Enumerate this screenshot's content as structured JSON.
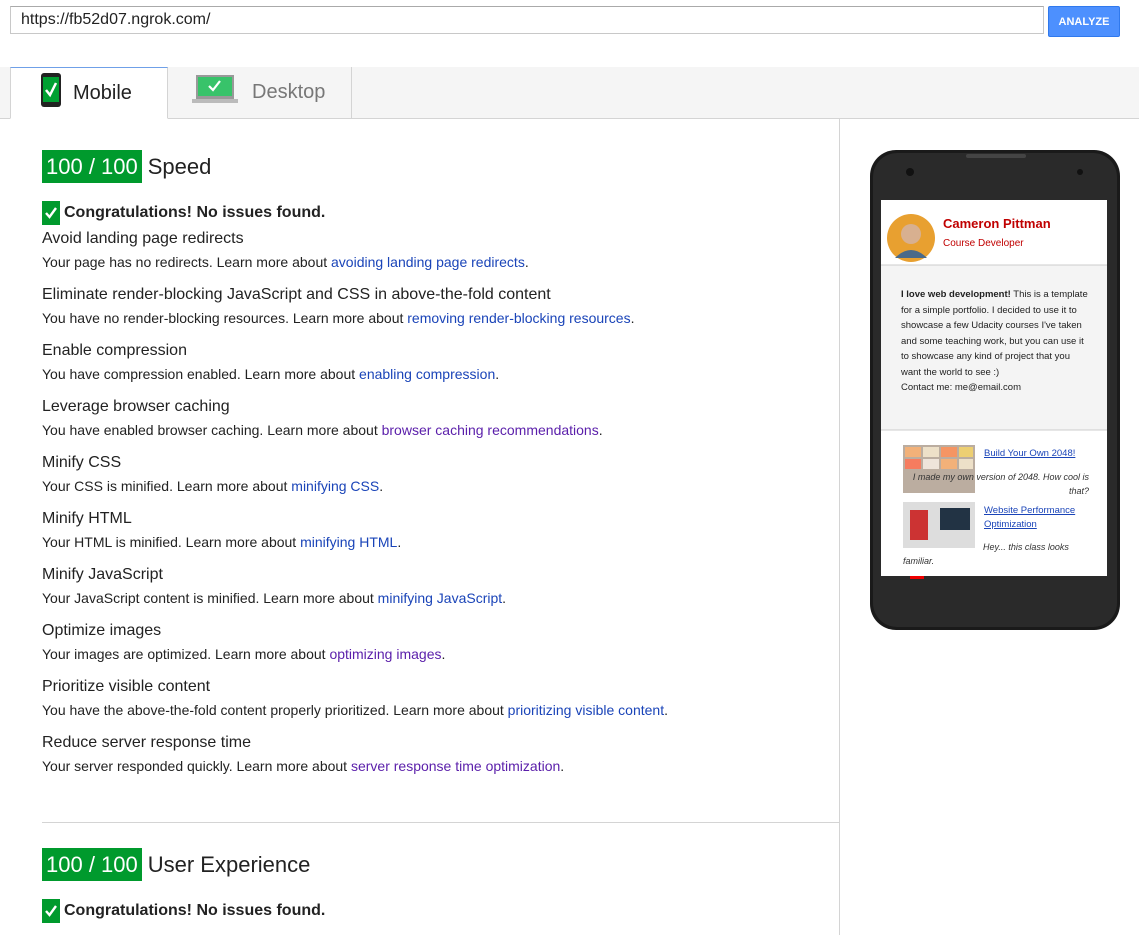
{
  "url_bar": {
    "value": "https://fb52d07.ngrok.com/",
    "analyze_label": "ANALYZE"
  },
  "tabs": [
    {
      "label": "Mobile",
      "active": true
    },
    {
      "label": "Desktop",
      "active": false
    }
  ],
  "speed": {
    "score": "100 / 100",
    "label": "Speed",
    "congrats": "Congratulations! No issues found.",
    "rules": [
      {
        "title": "Avoid landing page redirects",
        "desc": "Your page has no redirects. Learn more about ",
        "link": "avoiding landing page redirects",
        "visited": false
      },
      {
        "title": "Eliminate render-blocking JavaScript and CSS in above-the-fold content",
        "desc": "You have no render-blocking resources. Learn more about ",
        "link": "removing render-blocking resources",
        "visited": false
      },
      {
        "title": "Enable compression",
        "desc": "You have compression enabled. Learn more about ",
        "link": "enabling compression",
        "visited": false
      },
      {
        "title": "Leverage browser caching",
        "desc": "You have enabled browser caching. Learn more about ",
        "link": "browser caching recommendations",
        "visited": true
      },
      {
        "title": "Minify CSS",
        "desc": "Your CSS is minified. Learn more about ",
        "link": "minifying CSS",
        "visited": false
      },
      {
        "title": "Minify HTML",
        "desc": "Your HTML is minified. Learn more about ",
        "link": "minifying HTML",
        "visited": false
      },
      {
        "title": "Minify JavaScript",
        "desc": "Your JavaScript content is minified. Learn more about ",
        "link": "minifying JavaScript",
        "visited": false
      },
      {
        "title": "Optimize images",
        "desc": "Your images are optimized. Learn more about ",
        "link": "optimizing images",
        "visited": true
      },
      {
        "title": "Prioritize visible content",
        "desc": "You have the above-the-fold content properly prioritized. Learn more about ",
        "link": "prioritizing visible content",
        "visited": false
      },
      {
        "title": "Reduce server response time",
        "desc": "Your server responded quickly. Learn more about ",
        "link": "server response time optimization",
        "visited": true
      }
    ]
  },
  "ux": {
    "score": "100 / 100",
    "label": "User Experience",
    "congrats": "Congratulations! No issues found."
  },
  "preview": {
    "name": "Cameron Pittman",
    "role": "Course Developer",
    "bio_bold": "I love web development!",
    "bio": " This is a template for a simple portfolio. I decided to use it to showcase a few Udacity courses I've taken and some teaching work, but you can use it to showcase any kind of project that you want the world to see :)",
    "contact": "Contact me: me@email.com",
    "projects": [
      {
        "title": "Build Your Own 2048!",
        "desc": "I made my own version of 2048. How cool is that?"
      },
      {
        "title": "Website Performance Optimization",
        "desc": "Hey... this class looks familiar."
      }
    ]
  },
  "colors": {
    "score_green": "#009a2d",
    "link_blue": "#1a44b8",
    "link_visited": "#5a1eaa",
    "analyze_blue": "#4d90fe",
    "name_red": "#c00000"
  }
}
